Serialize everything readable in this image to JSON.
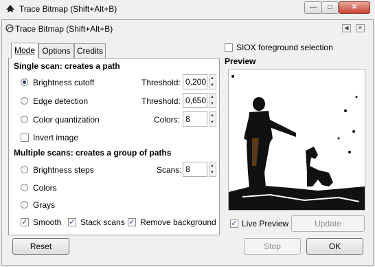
{
  "window": {
    "title": "Trace Bitmap (Shift+Alt+B)",
    "minimize_glyph": "—",
    "maximize_glyph": "□",
    "close_glyph": "✕"
  },
  "dock": {
    "title": "Trace Bitmap (Shift+Alt+B)"
  },
  "tabs": [
    {
      "label": "Mode"
    },
    {
      "label": "Options"
    },
    {
      "label": "Credits"
    }
  ],
  "single_scan": {
    "heading": "Single scan: creates a path",
    "brightness_cutoff": {
      "label": "Brightness cutoff",
      "selected": true,
      "threshold_label": "Threshold:",
      "threshold_value": "0,200"
    },
    "edge_detection": {
      "label": "Edge detection",
      "selected": false,
      "threshold_label": "Threshold:",
      "threshold_value": "0,650"
    },
    "color_quantization": {
      "label": "Color quantization",
      "selected": false,
      "colors_label": "Colors:",
      "colors_value": "8"
    },
    "invert_image": {
      "label": "Invert image",
      "checked": false
    }
  },
  "multi_scan": {
    "heading": "Multiple scans: creates a group of paths",
    "brightness_steps": {
      "label": "Brightness steps",
      "selected": false,
      "scans_label": "Scans:",
      "scans_value": "8"
    },
    "colors": {
      "label": "Colors",
      "selected": false
    },
    "grays": {
      "label": "Grays",
      "selected": false
    },
    "smooth": {
      "label": "Smooth",
      "checked": true
    },
    "stack_scans": {
      "label": "Stack scans",
      "checked": true
    },
    "remove_background": {
      "label": "Remove background",
      "checked": true
    }
  },
  "siox": {
    "label": "SIOX foreground selection",
    "checked": false
  },
  "preview": {
    "heading": "Preview",
    "live_preview": {
      "label": "Live Preview",
      "checked": true
    },
    "update_label": "Update"
  },
  "buttons": {
    "reset": "Reset",
    "stop": "Stop",
    "ok": "OK"
  }
}
